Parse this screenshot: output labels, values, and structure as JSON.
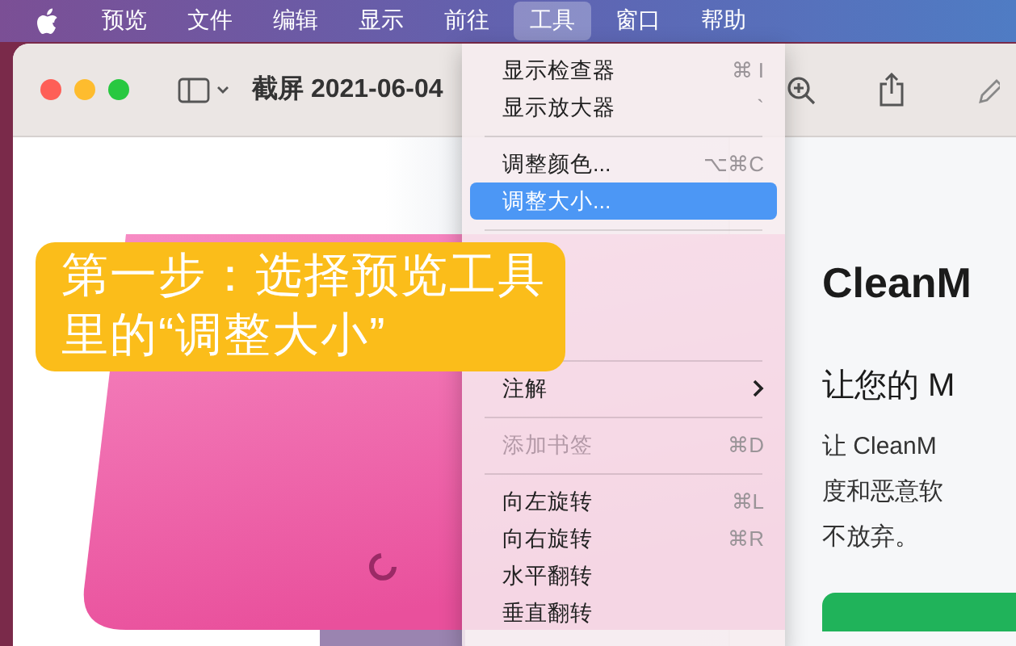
{
  "menu_bar": {
    "items": [
      {
        "label": "预览",
        "selected": false
      },
      {
        "label": "文件",
        "selected": false
      },
      {
        "label": "编辑",
        "selected": false
      },
      {
        "label": "显示",
        "selected": false
      },
      {
        "label": "前往",
        "selected": false
      },
      {
        "label": "工具",
        "selected": true
      },
      {
        "label": "窗口",
        "selected": false
      },
      {
        "label": "帮助",
        "selected": false
      }
    ]
  },
  "window": {
    "title": "截屏 2021-06-04"
  },
  "document": {
    "heading": "CleanM",
    "subheading": "让您的 M",
    "paragraph_lines": [
      "让 CleanM",
      "度和恶意软",
      "不放弃。"
    ]
  },
  "menu": {
    "items": [
      {
        "kind": "item",
        "label": "显示检查器",
        "shortcut": "⌘ I",
        "selected": false,
        "disabled": false
      },
      {
        "kind": "item",
        "label": "显示放大器",
        "shortcut": "`",
        "selected": false,
        "disabled": false
      },
      {
        "kind": "separator"
      },
      {
        "kind": "item",
        "label": "调整颜色...",
        "shortcut": "⌥⌘C",
        "selected": false,
        "disabled": false
      },
      {
        "kind": "item",
        "label": "调整大小...",
        "selected": true,
        "disabled": false
      },
      {
        "kind": "separator"
      },
      {
        "kind": "covered"
      },
      {
        "kind": "covered"
      },
      {
        "kind": "covered"
      },
      {
        "kind": "separator"
      },
      {
        "kind": "submenu",
        "label": "注解",
        "selected": false,
        "disabled": false
      },
      {
        "kind": "separator"
      },
      {
        "kind": "item",
        "label": "添加书签",
        "shortcut": "⌘D",
        "selected": false,
        "disabled": true
      },
      {
        "kind": "separator"
      },
      {
        "kind": "item",
        "label": "向左旋转",
        "shortcut": "⌘L",
        "selected": false,
        "disabled": false
      },
      {
        "kind": "item",
        "label": "向右旋转",
        "shortcut": "⌘R",
        "selected": false,
        "disabled": false
      },
      {
        "kind": "item",
        "label": "水平翻转",
        "selected": false,
        "disabled": false
      },
      {
        "kind": "item",
        "label": "垂直翻转",
        "selected": false,
        "disabled": false
      }
    ]
  },
  "annotation": {
    "lines": [
      "第一步：选择预览工具",
      "里的“调整大小”"
    ]
  }
}
